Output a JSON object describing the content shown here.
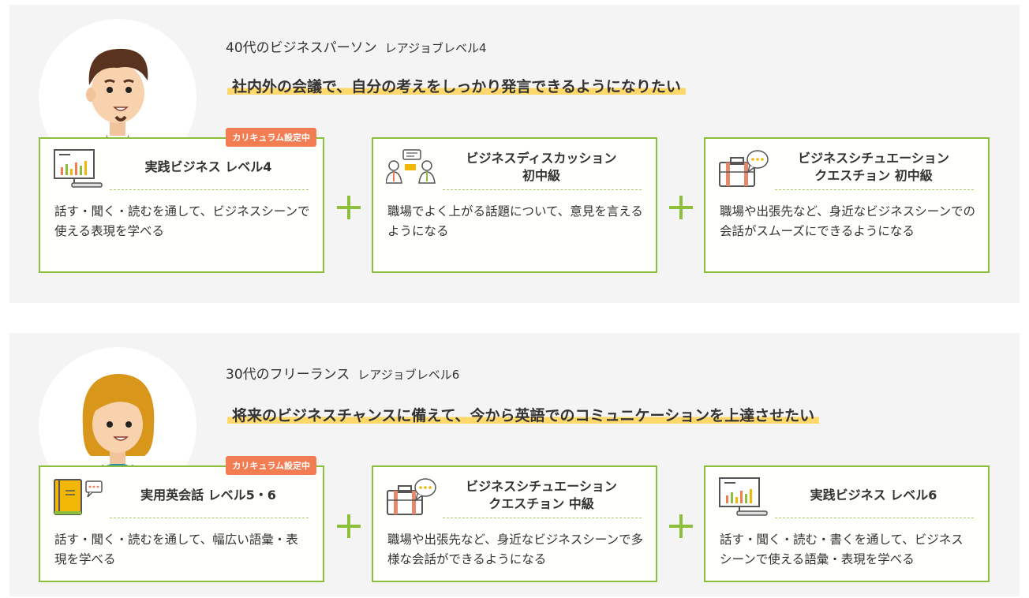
{
  "sections": [
    {
      "persona": "40代のビジネスパーソン",
      "level": "レアジョブレベル4",
      "goal": "社内外の会議で、自分の考えをしっかり発言できるようになりたい",
      "cards": [
        {
          "badge": "カリキュラム設定中",
          "title": "実践ビジネス レベル4",
          "desc": "話す・聞く・読むを通して、ビジネスシーンで使える表現を学べる",
          "icon": "presentation-board-icon"
        },
        {
          "title": "ビジネスディスカッション\n初中級",
          "desc": "職場でよく上がる話題について、意見を言えるようになる",
          "icon": "discussion-people-icon"
        },
        {
          "title": "ビジネスシチュエーション\nクエスチョン 初中級",
          "desc": "職場や出張先など、身近なビジネスシーンでの会話がスムーズにできるようになる",
          "icon": "briefcase-chat-icon"
        }
      ]
    },
    {
      "persona": "30代のフリーランス",
      "level": "レアジョブレベル6",
      "goal": "将来のビジネスチャンスに備えて、今から英語でのコミュニケーションを上達させたい",
      "cards": [
        {
          "badge": "カリキュラム設定中",
          "title": "実用英会話 レベル5・6",
          "desc": "話す・聞く・読むを通して、幅広い語彙・表現を学べる",
          "icon": "book-chat-icon"
        },
        {
          "title": "ビジネスシチュエーション\nクエスチョン 中級",
          "desc": "職場や出張先など、身近なビジネスシーンで多様な会話ができるようになる",
          "icon": "briefcase-chat-icon"
        },
        {
          "title": "実践ビジネス レベル6",
          "desc": "話す・聞く・読む・書くを通して、ビジネスシーンで使える語彙・表現を学べる",
          "icon": "presentation-board-icon"
        }
      ]
    }
  ],
  "colors": {
    "accent_green": "#8dbe3c",
    "badge_orange": "#f27d52",
    "highlight_yellow": "#ffd86b",
    "panel_bg": "#f4f4f4"
  }
}
